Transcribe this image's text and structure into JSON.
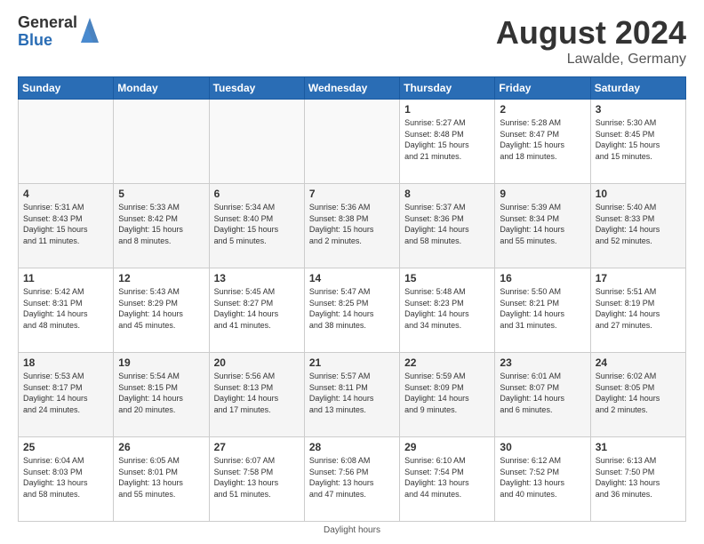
{
  "logo": {
    "general": "General",
    "blue": "Blue"
  },
  "title": {
    "month": "August 2024",
    "location": "Lawalde, Germany"
  },
  "headers": [
    "Sunday",
    "Monday",
    "Tuesday",
    "Wednesday",
    "Thursday",
    "Friday",
    "Saturday"
  ],
  "weeks": [
    [
      {
        "day": "",
        "info": ""
      },
      {
        "day": "",
        "info": ""
      },
      {
        "day": "",
        "info": ""
      },
      {
        "day": "",
        "info": ""
      },
      {
        "day": "1",
        "info": "Sunrise: 5:27 AM\nSunset: 8:48 PM\nDaylight: 15 hours\nand 21 minutes."
      },
      {
        "day": "2",
        "info": "Sunrise: 5:28 AM\nSunset: 8:47 PM\nDaylight: 15 hours\nand 18 minutes."
      },
      {
        "day": "3",
        "info": "Sunrise: 5:30 AM\nSunset: 8:45 PM\nDaylight: 15 hours\nand 15 minutes."
      }
    ],
    [
      {
        "day": "4",
        "info": "Sunrise: 5:31 AM\nSunset: 8:43 PM\nDaylight: 15 hours\nand 11 minutes."
      },
      {
        "day": "5",
        "info": "Sunrise: 5:33 AM\nSunset: 8:42 PM\nDaylight: 15 hours\nand 8 minutes."
      },
      {
        "day": "6",
        "info": "Sunrise: 5:34 AM\nSunset: 8:40 PM\nDaylight: 15 hours\nand 5 minutes."
      },
      {
        "day": "7",
        "info": "Sunrise: 5:36 AM\nSunset: 8:38 PM\nDaylight: 15 hours\nand 2 minutes."
      },
      {
        "day": "8",
        "info": "Sunrise: 5:37 AM\nSunset: 8:36 PM\nDaylight: 14 hours\nand 58 minutes."
      },
      {
        "day": "9",
        "info": "Sunrise: 5:39 AM\nSunset: 8:34 PM\nDaylight: 14 hours\nand 55 minutes."
      },
      {
        "day": "10",
        "info": "Sunrise: 5:40 AM\nSunset: 8:33 PM\nDaylight: 14 hours\nand 52 minutes."
      }
    ],
    [
      {
        "day": "11",
        "info": "Sunrise: 5:42 AM\nSunset: 8:31 PM\nDaylight: 14 hours\nand 48 minutes."
      },
      {
        "day": "12",
        "info": "Sunrise: 5:43 AM\nSunset: 8:29 PM\nDaylight: 14 hours\nand 45 minutes."
      },
      {
        "day": "13",
        "info": "Sunrise: 5:45 AM\nSunset: 8:27 PM\nDaylight: 14 hours\nand 41 minutes."
      },
      {
        "day": "14",
        "info": "Sunrise: 5:47 AM\nSunset: 8:25 PM\nDaylight: 14 hours\nand 38 minutes."
      },
      {
        "day": "15",
        "info": "Sunrise: 5:48 AM\nSunset: 8:23 PM\nDaylight: 14 hours\nand 34 minutes."
      },
      {
        "day": "16",
        "info": "Sunrise: 5:50 AM\nSunset: 8:21 PM\nDaylight: 14 hours\nand 31 minutes."
      },
      {
        "day": "17",
        "info": "Sunrise: 5:51 AM\nSunset: 8:19 PM\nDaylight: 14 hours\nand 27 minutes."
      }
    ],
    [
      {
        "day": "18",
        "info": "Sunrise: 5:53 AM\nSunset: 8:17 PM\nDaylight: 14 hours\nand 24 minutes."
      },
      {
        "day": "19",
        "info": "Sunrise: 5:54 AM\nSunset: 8:15 PM\nDaylight: 14 hours\nand 20 minutes."
      },
      {
        "day": "20",
        "info": "Sunrise: 5:56 AM\nSunset: 8:13 PM\nDaylight: 14 hours\nand 17 minutes."
      },
      {
        "day": "21",
        "info": "Sunrise: 5:57 AM\nSunset: 8:11 PM\nDaylight: 14 hours\nand 13 minutes."
      },
      {
        "day": "22",
        "info": "Sunrise: 5:59 AM\nSunset: 8:09 PM\nDaylight: 14 hours\nand 9 minutes."
      },
      {
        "day": "23",
        "info": "Sunrise: 6:01 AM\nSunset: 8:07 PM\nDaylight: 14 hours\nand 6 minutes."
      },
      {
        "day": "24",
        "info": "Sunrise: 6:02 AM\nSunset: 8:05 PM\nDaylight: 14 hours\nand 2 minutes."
      }
    ],
    [
      {
        "day": "25",
        "info": "Sunrise: 6:04 AM\nSunset: 8:03 PM\nDaylight: 13 hours\nand 58 minutes."
      },
      {
        "day": "26",
        "info": "Sunrise: 6:05 AM\nSunset: 8:01 PM\nDaylight: 13 hours\nand 55 minutes."
      },
      {
        "day": "27",
        "info": "Sunrise: 6:07 AM\nSunset: 7:58 PM\nDaylight: 13 hours\nand 51 minutes."
      },
      {
        "day": "28",
        "info": "Sunrise: 6:08 AM\nSunset: 7:56 PM\nDaylight: 13 hours\nand 47 minutes."
      },
      {
        "day": "29",
        "info": "Sunrise: 6:10 AM\nSunset: 7:54 PM\nDaylight: 13 hours\nand 44 minutes."
      },
      {
        "day": "30",
        "info": "Sunrise: 6:12 AM\nSunset: 7:52 PM\nDaylight: 13 hours\nand 40 minutes."
      },
      {
        "day": "31",
        "info": "Sunrise: 6:13 AM\nSunset: 7:50 PM\nDaylight: 13 hours\nand 36 minutes."
      }
    ]
  ],
  "footer": "Daylight hours"
}
